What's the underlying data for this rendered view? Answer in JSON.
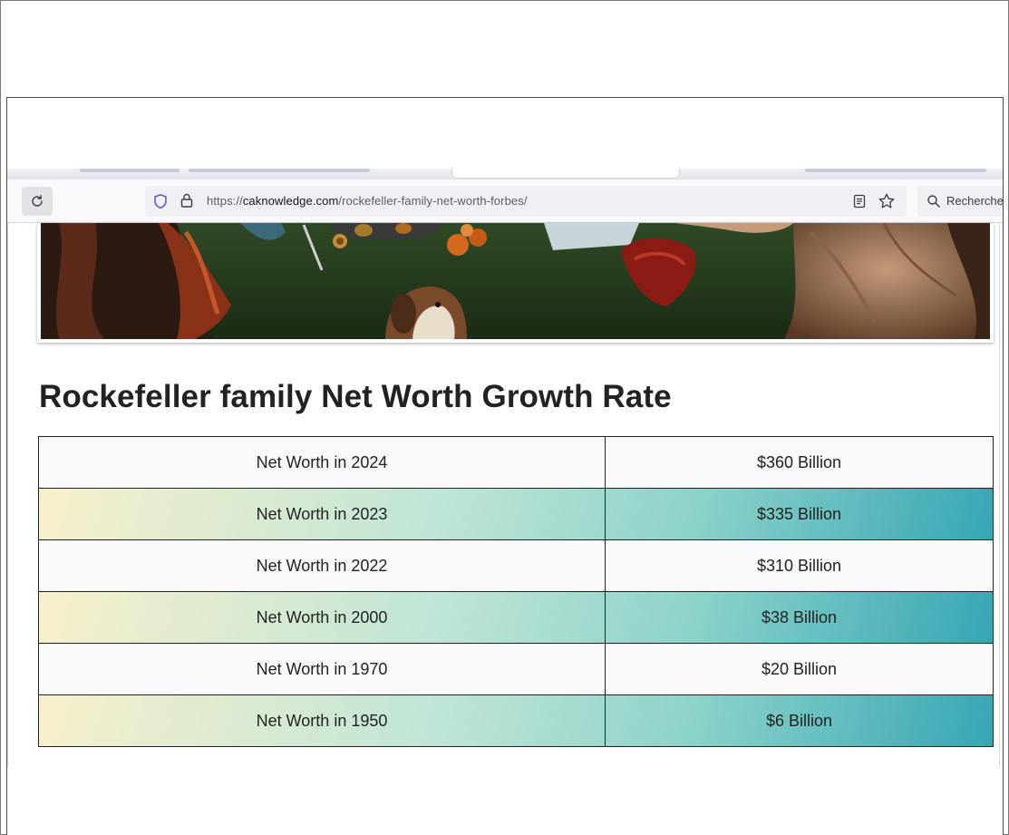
{
  "browser": {
    "url_prefix": "https://",
    "url_host": "caknowledge.com",
    "url_path": "/rockefeller-family-net-worth-forbes/",
    "search_placeholder": "Recherche"
  },
  "page": {
    "heading": "Rockefeller family Net Worth Growth Rate",
    "table": [
      {
        "label": "Net Worth in 2024",
        "value": "$360 Billion"
      },
      {
        "label": "Net Worth in 2023",
        "value": "$335 Billion"
      },
      {
        "label": "Net Worth in 2022",
        "value": "$310 Billion"
      },
      {
        "label": "Net Worth in 2000",
        "value": "$38 Billion"
      },
      {
        "label": "Net Worth in 1970",
        "value": "$20 Billion"
      },
      {
        "label": "Net Worth in 1950",
        "value": "$6 Billion"
      }
    ]
  },
  "icons": [
    "reload-icon",
    "shield-icon",
    "lock-icon",
    "reader-view-icon",
    "bookmark-star-icon",
    "search-icon"
  ],
  "colors": {
    "gradient_start": "#f8f0cc",
    "gradient_end": "#36a6b4",
    "plain_row": "#f9f9f9"
  }
}
